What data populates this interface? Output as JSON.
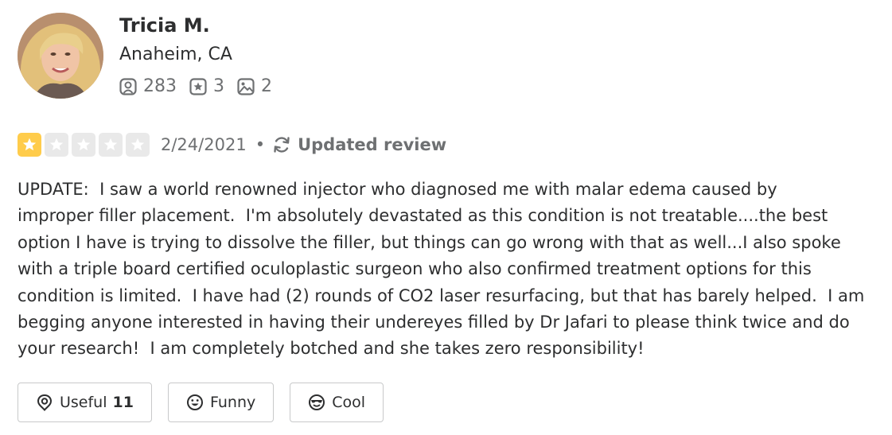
{
  "user": {
    "name": "Tricia M.",
    "location": "Anaheim, CA",
    "stats": {
      "friends": "283",
      "reviews": "3",
      "photos": "2"
    },
    "avatar_icon": "profile-photo"
  },
  "review": {
    "rating": 1,
    "rating_max": 5,
    "date": "2/24/2021",
    "separator": "•",
    "updated_label": "Updated review",
    "text": "UPDATE:  I saw a world renowned injector who diagnosed me with malar edema caused by\nimproper filler placement.  I'm absolutely devastated as this condition is not treatable....the best\noption I have is trying to dissolve the filler, but things can go wrong with that as well...I also spoke\nwith a triple board certified oculoplastic surgeon who also confirmed treatment options for this\ncondition is limited.  I have had (2) rounds of CO2 laser resurfacing, but that has barely helped.  I am\nbegging anyone interested in having their undereyes filled by Dr Jafari to please think twice and do\nyour research!  I am completely botched and she takes zero responsibility!"
  },
  "actions": {
    "useful_label": "Useful",
    "useful_count": "11",
    "funny_label": "Funny",
    "cool_label": "Cool"
  },
  "colors": {
    "star_active": "#ffcc4b",
    "star_inactive": "#e9e9e9",
    "text_primary": "#2d2e2f",
    "text_secondary": "#6e7072"
  },
  "icons": [
    "friends-icon",
    "reviews-icon",
    "photos-icon",
    "star-icon",
    "refresh-icon",
    "useful-icon",
    "funny-icon",
    "cool-icon"
  ]
}
